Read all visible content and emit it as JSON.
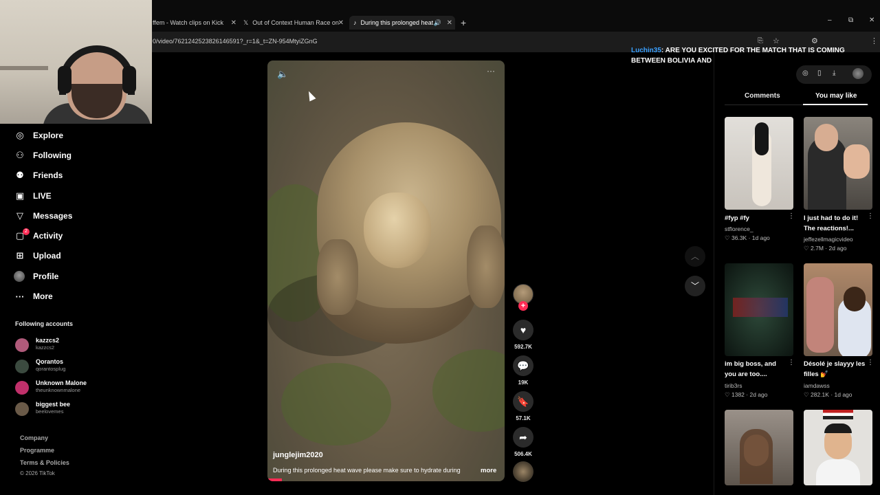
{
  "browser": {
    "tabs": [
      {
        "label": "ffem - Watch clips on Kick",
        "active": false
      },
      {
        "label": "Out of Context Human Race on",
        "active": false
      },
      {
        "label": "During this prolonged heat",
        "active": true
      }
    ],
    "new_tab": "+",
    "url": "0/video/7621242523826146591?_r=1&_t=ZN-954MtyiZGnG",
    "window_controls": {
      "minimize": "–",
      "restore": "⧉",
      "close": "✕"
    }
  },
  "sidebar": {
    "items": [
      {
        "label": "Explore",
        "icon": "compass-icon",
        "glyph": "◎"
      },
      {
        "label": "Following",
        "icon": "person-icon",
        "glyph": "⚇"
      },
      {
        "label": "Friends",
        "icon": "friends-icon",
        "glyph": "⚉"
      },
      {
        "label": "LIVE",
        "icon": "live-tv-icon",
        "glyph": "▣"
      },
      {
        "label": "Messages",
        "icon": "send-icon",
        "glyph": "▽"
      },
      {
        "label": "Activity",
        "icon": "inbox-icon",
        "glyph": "▢"
      },
      {
        "label": "Upload",
        "icon": "plus-square-icon",
        "glyph": "⊞"
      },
      {
        "label": "Profile",
        "icon": "avatar-icon",
        "glyph": "●"
      },
      {
        "label": "More",
        "icon": "more-icon",
        "glyph": "···"
      }
    ],
    "activity_badge": "2",
    "following_title": "Following accounts",
    "accounts": [
      {
        "name": "kazzcs2",
        "handle": "kazzcs2",
        "color": "#b05a7a"
      },
      {
        "name": "Qorantos",
        "handle": "qorantosplug",
        "color": "#3b4a3f"
      },
      {
        "name": "Unknown Malone",
        "handle": "theunknownmalone",
        "color": "#c0306a"
      },
      {
        "name": "biggest bee",
        "handle": "beelovemes",
        "color": "#6a5a48"
      }
    ],
    "footer": [
      "Company",
      "Programme",
      "Terms & Policies",
      "© 2026 TikTok"
    ]
  },
  "video": {
    "username": "junglejim2020",
    "caption": "During this prolonged heat wave please make sure to hydrate during",
    "more": "more",
    "progress": 0.06
  },
  "actions": {
    "likes": "592.7K",
    "comments": "19K",
    "saves": "57.1K",
    "shares": "506.4K"
  },
  "chat": {
    "user": "Luchin35",
    "message": ": ARE YOU EXCITED FOR THE MATCH THAT IS COMING BETWEEN BOLIVIA AND IRAK?"
  },
  "panel": {
    "tabs": [
      "Comments",
      "You may like"
    ],
    "recommendations": [
      {
        "title": "#fyp #fy",
        "user": "stflorence_",
        "likes": "36.3K",
        "age": "1d ago",
        "thumb": "#d6d2cc"
      },
      {
        "title": "I just had to do it! The reactions!...",
        "user": "jeffezellmagicvideo",
        "likes": "2.7M",
        "age": "2d ago",
        "thumb": "#6c6862"
      },
      {
        "title": "im big boss, and you are too....",
        "user": "tirib3rs",
        "likes": "1382",
        "age": "2d ago",
        "thumb": "#1b2b22"
      },
      {
        "title": "Désolé je slayyy les filles 💅",
        "user": "iamdawss",
        "likes": "282.1K",
        "age": "1d ago",
        "thumb": "#9a7a5e"
      },
      {
        "title": "",
        "user": "",
        "likes": "",
        "age": "",
        "thumb": "#8a8076"
      },
      {
        "title": "",
        "user": "",
        "likes": "",
        "age": "",
        "thumb": "#d9d6d2"
      }
    ]
  }
}
